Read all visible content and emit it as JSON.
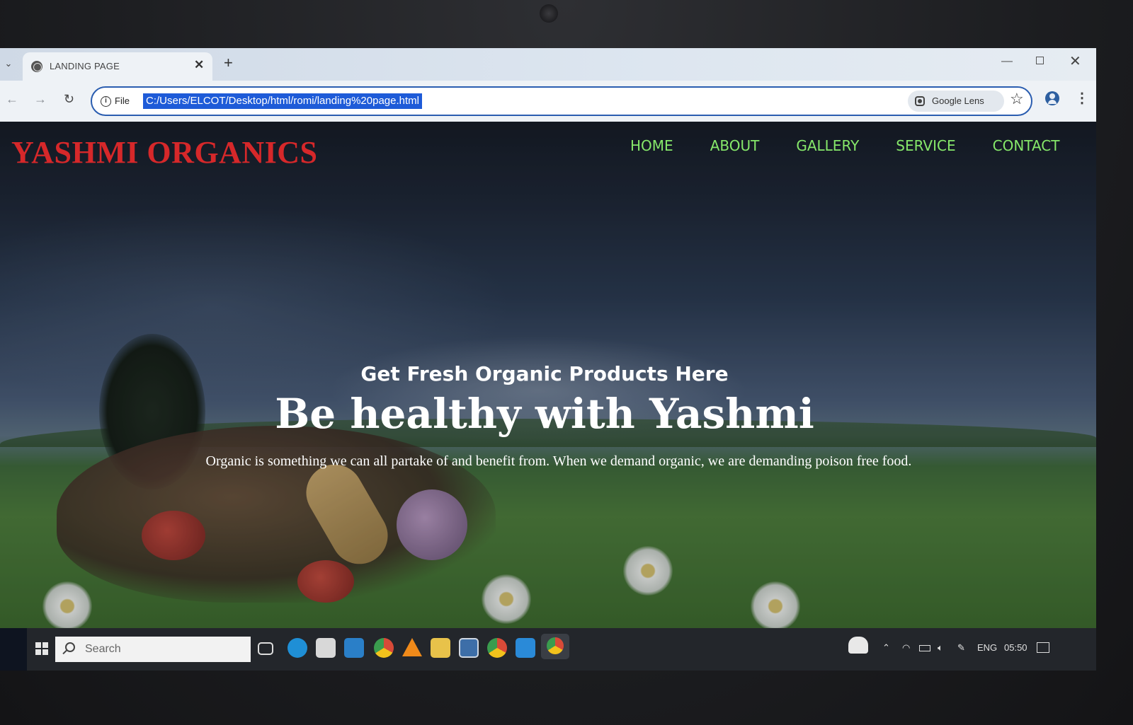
{
  "browser": {
    "tab_title": "LANDING PAGE",
    "tab_close_glyph": "✕",
    "new_tab_glyph": "+",
    "omnibox": {
      "security_chip": "File",
      "url": "C:/Users/ELCOT/Desktop/html/romi/landing%20page.html",
      "lens_label": "Google Lens"
    },
    "accent_color": "#2a5db0"
  },
  "site": {
    "brand": "YASHMI ORGANICS",
    "brand_color": "#d6282a",
    "nav_color": "#86e86a",
    "nav": [
      {
        "label": "HOME"
      },
      {
        "label": "ABOUT"
      },
      {
        "label": "GALLERY"
      },
      {
        "label": "SERVICE"
      },
      {
        "label": "CONTACT"
      }
    ],
    "hero": {
      "subtitle": "Get Fresh Organic Products Here",
      "title": "Be healthy with Yashmi",
      "text": "Organic is something we can all partake of and benefit from. When we demand organic, we are demanding poison free food."
    }
  },
  "taskbar": {
    "search_placeholder": "Search",
    "apps": [
      "task-view-icon",
      "edge-icon",
      "store-icon",
      "mail-icon",
      "chrome-icon",
      "vlc-icon",
      "file-explorer-icon",
      "photos-icon",
      "chrome-icon",
      "vscode-icon",
      "chrome-active-icon"
    ],
    "tray": {
      "language": "ENG",
      "time": "05:50"
    }
  }
}
